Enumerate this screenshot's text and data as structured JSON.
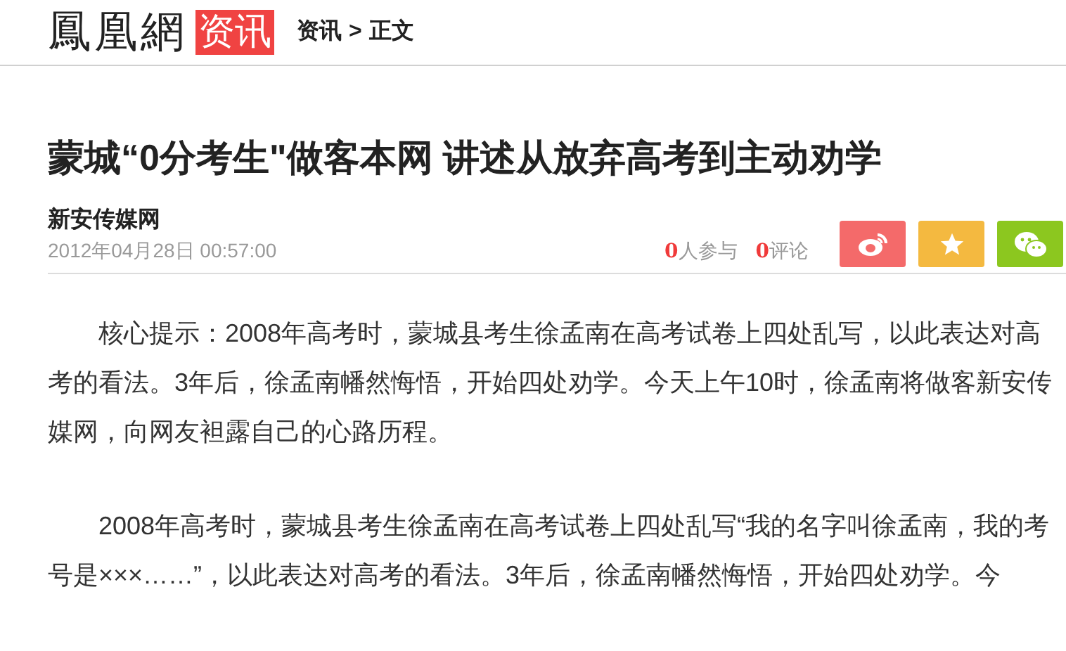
{
  "header": {
    "logo": "鳳凰網",
    "channel": "资讯",
    "breadcrumb": [
      "资讯",
      ">",
      "正文"
    ]
  },
  "article": {
    "title": "蒙城“0分考生\"做客本网 讲述从放弃高考到主动劝学",
    "source": "新安传媒网",
    "date": "2012年04月28日 00:57:00",
    "stats": [
      {
        "count": "0",
        "label": "人参与"
      },
      {
        "count": "0",
        "label": "评论"
      }
    ],
    "share_buttons": [
      {
        "kind": "weibo",
        "color": "#f46a6a"
      },
      {
        "kind": "favorite",
        "color": "#f4b940"
      },
      {
        "kind": "wechat",
        "color": "#8cc71f"
      }
    ],
    "paragraphs": [
      "核心提示：2008年高考时，蒙城县考生徐孟南在高考试卷上四处乱写，以此表达对高考的看法。3年后，徐孟南幡然悔悟，开始四处劝学。今天上午10时，徐孟南将做客新安传媒网，向网友袒露自己的心路历程。",
      "2008年高考时，蒙城县考生徐孟南在高考试卷上四处乱写“我的名字叫徐孟南，我的考号是×××……”，以此表达对高考的看法。3年后，徐孟南幡然悔悟，开始四处劝学。今"
    ]
  }
}
